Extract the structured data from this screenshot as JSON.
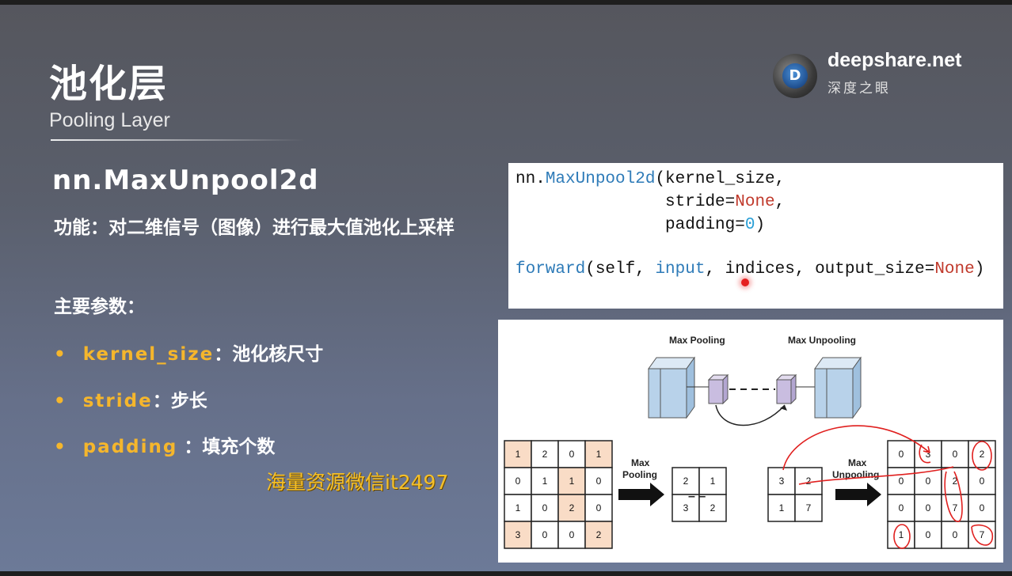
{
  "slide": {
    "title": "池化层",
    "subtitle": "Pooling Layer",
    "brand": {
      "name": "deepshare.net",
      "tagline": "深度之眼",
      "logo_letter": "D"
    },
    "function_name": "nn.MaxUnpool2d",
    "description": "功能：对二维信号（图像）进行最大值池化上采样",
    "params_title": "主要参数：",
    "params": [
      {
        "name": "kernel_size",
        "sep": "：",
        "desc": "池化核尺寸"
      },
      {
        "name": "stride",
        "sep": "：",
        "desc": "步长"
      },
      {
        "name": "padding",
        "sep": " ：",
        "desc": "填充个数"
      }
    ],
    "watermark": "海量资源微信it2497"
  },
  "code": {
    "line1_a": "nn.",
    "line1_b": "MaxUnpool2d",
    "line1_c": "(kernel_size,",
    "line2_a": "               stride=",
    "line2_b": "None",
    "line2_c": ",",
    "line3_a": "               padding=",
    "line3_b": "0",
    "line3_c": ")",
    "line4_a": "forward",
    "line4_b": "(self, ",
    "line4_c": "input",
    "line4_d": ", indices, output_size=",
    "line4_e": "None",
    "line4_f": ")"
  },
  "diagram": {
    "label_max_pooling_top": "Max Pooling",
    "label_max_unpooling_top": "Max Unpooling",
    "label_max_pooling_arrow": [
      "Max",
      "Pooling"
    ],
    "label_max_unpooling_arrow": [
      "Max",
      "Unpooling"
    ],
    "dots": "– –",
    "input_grid": [
      [
        "1",
        "2",
        "0",
        "1"
      ],
      [
        "0",
        "1",
        "1",
        "0"
      ],
      [
        "1",
        "0",
        "2",
        "0"
      ],
      [
        "3",
        "0",
        "0",
        "2"
      ]
    ],
    "input_highlight": [
      [
        1,
        0,
        0,
        1
      ],
      [
        0,
        0,
        1,
        0
      ],
      [
        0,
        0,
        1,
        0
      ],
      [
        1,
        0,
        0,
        1
      ]
    ],
    "pooled_grid": [
      [
        "2",
        "1"
      ],
      [
        "3",
        "2"
      ]
    ],
    "indices_grid": [
      [
        "3",
        "2"
      ],
      [
        "1",
        "7"
      ]
    ],
    "output_grid": [
      [
        "0",
        "3",
        "0",
        "2"
      ],
      [
        "0",
        "0",
        "2",
        "0"
      ],
      [
        "0",
        "0",
        "7",
        "0"
      ],
      [
        "1",
        "0",
        "0",
        "7"
      ]
    ],
    "highlight_color": "#f9dcc6",
    "annotation_color": "#e0201f"
  }
}
